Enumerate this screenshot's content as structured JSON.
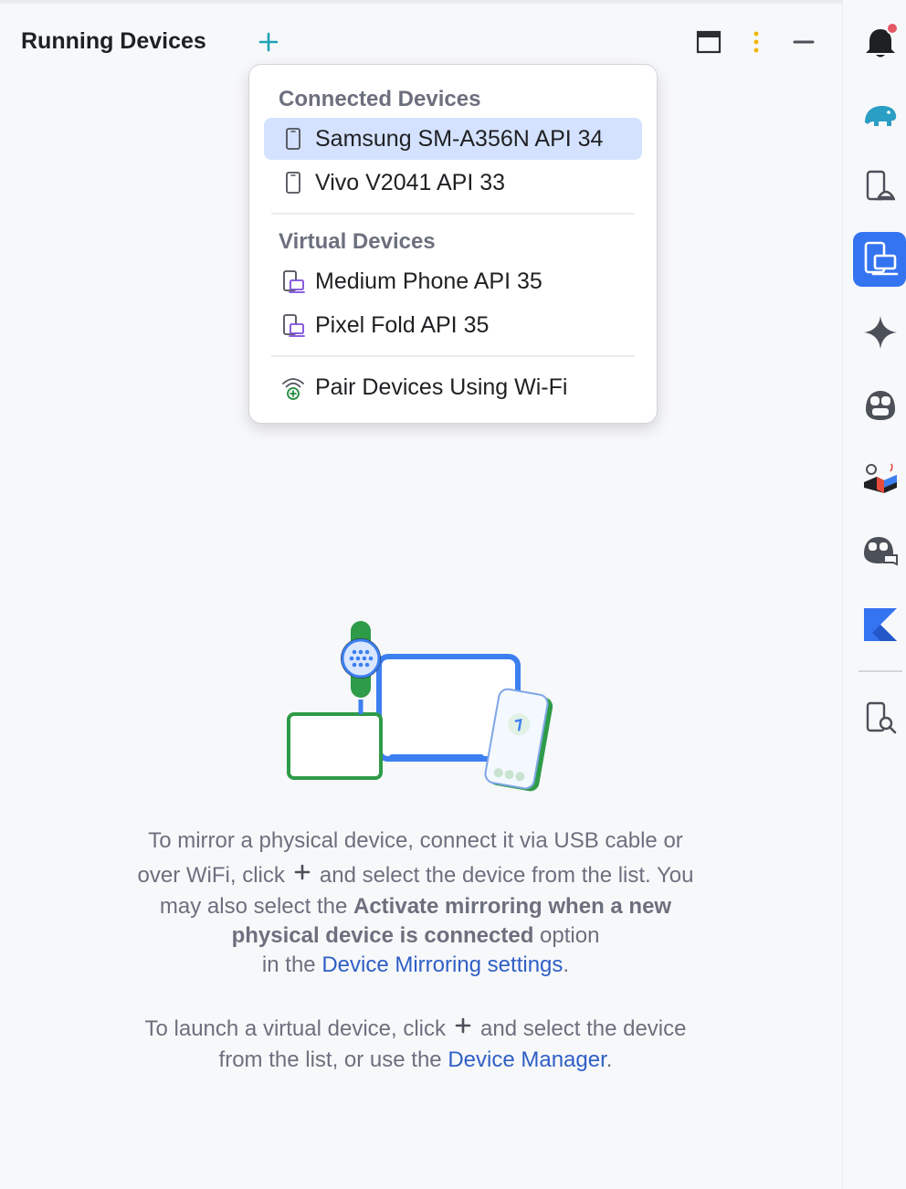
{
  "header": {
    "title": "Running Devices"
  },
  "popup": {
    "connected_header": "Connected Devices",
    "connected_devices": [
      {
        "label": "Samsung SM-A356N API 34",
        "selected": true
      },
      {
        "label": "Vivo V2041 API 33",
        "selected": false
      }
    ],
    "virtual_header": "Virtual Devices",
    "virtual_devices": [
      {
        "label": "Medium Phone API 35"
      },
      {
        "label": "Pixel Fold API 35"
      }
    ],
    "pair_label": "Pair Devices Using Wi-Fi"
  },
  "empty_state": {
    "mirror_l1": "To mirror a physical device, connect it via USB cable or",
    "mirror_l2a": "over WiFi, click",
    "mirror_l2b": "and select the device from the list. You",
    "mirror_l3a": "may also select the",
    "mirror_l3_bold": "Activate mirroring when a new",
    "mirror_l4_bold": "physical device is connected",
    "mirror_l4b": "option",
    "mirror_l5a": "in the",
    "mirror_l5_link": "Device Mirroring settings",
    "mirror_l5b": ".",
    "launch_l1a": "To launch a virtual device, click",
    "launch_l1b": "and select the device",
    "launch_l2a": "from the list, or use the",
    "launch_l2_link": "Device Manager",
    "launch_l2b": "."
  },
  "toolwindows": [
    {
      "icon": "notifications-bell-icon",
      "badge": true
    },
    {
      "icon": "gradle-elephant-icon"
    },
    {
      "icon": "device-manager-icon"
    },
    {
      "icon": "running-devices-icon",
      "active": true
    },
    {
      "icon": "gemini-sparkle-icon"
    },
    {
      "icon": "copilot-icon"
    },
    {
      "icon": "app-quality-insights-icon"
    },
    {
      "icon": "copilot-chat-icon"
    },
    {
      "icon": "kotlin-icon"
    },
    {
      "icon": "device-explorer-icon"
    }
  ],
  "colors": {
    "accent": "#3574f0",
    "selection": "#d4e2ff",
    "link": "#2f5fc6",
    "plus": "#1ca3b8"
  }
}
